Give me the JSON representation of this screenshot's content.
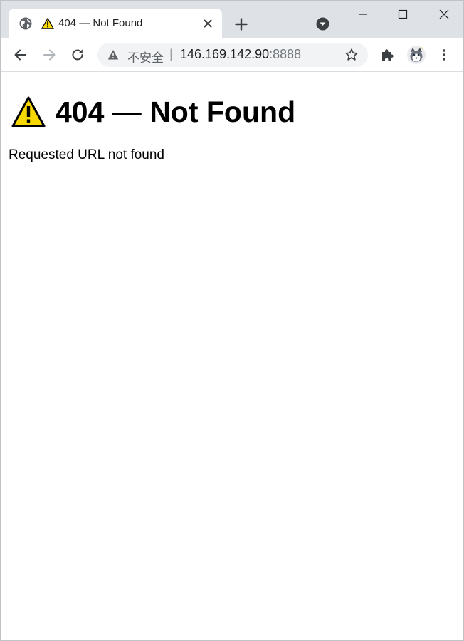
{
  "browser": {
    "tab": {
      "title": "404 — Not Found"
    },
    "omnibox": {
      "security_label": "不安全",
      "separator": "|",
      "url_host": "146.169.142.90",
      "url_port": ":8888"
    }
  },
  "page": {
    "heading": "404 — Not Found",
    "message": "Requested URL not found"
  },
  "colors": {
    "tabstrip_bg": "#dee1e6",
    "omnibox_bg": "#f1f3f4",
    "warning_yellow": "#f7d800",
    "icon_gray": "#5f6368"
  },
  "icons": {
    "tab_favicon": "globe-icon",
    "tab_status": "warning-icon",
    "security": "warning-icon",
    "bookmark": "star-icon",
    "extensions": "puzzle-icon",
    "profile": "avatar",
    "heading_icon": "warning-icon"
  }
}
